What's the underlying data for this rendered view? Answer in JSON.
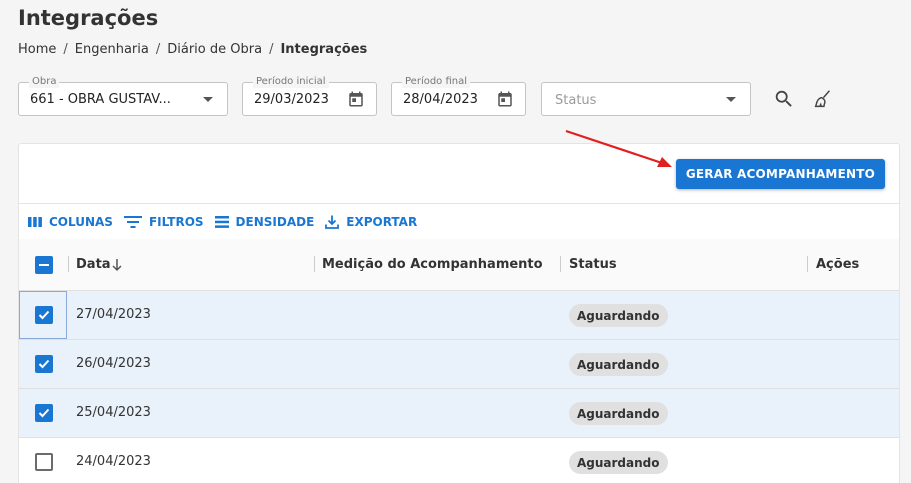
{
  "page": {
    "title": "Integrações"
  },
  "breadcrumb": [
    "Home",
    "Engenharia",
    "Diário de Obra",
    "Integrações"
  ],
  "filters": {
    "obra": {
      "label": "Obra",
      "value": "661 - OBRA GUSTAV..."
    },
    "periodo_inicial": {
      "label": "Período inicial",
      "value": "29/03/2023"
    },
    "periodo_final": {
      "label": "Período final",
      "value": "28/04/2023"
    },
    "status": {
      "placeholder": "Status"
    }
  },
  "actions": {
    "gerar_label": "GERAR ACOMPANHAMENTO"
  },
  "toolbar": {
    "colunas": "COLUNAS",
    "filtros": "FILTROS",
    "densidade": "DENSIDADE",
    "exportar": "EXPORTAR"
  },
  "table": {
    "columns": [
      "Data",
      "Medição do Acompanhamento",
      "Status",
      "Ações"
    ],
    "rows": [
      {
        "date": "27/04/2023",
        "status": "Aguardando",
        "checked": true
      },
      {
        "date": "26/04/2023",
        "status": "Aguardando",
        "checked": true
      },
      {
        "date": "25/04/2023",
        "status": "Aguardando",
        "checked": true
      },
      {
        "date": "24/04/2023",
        "status": "Aguardando",
        "checked": false
      }
    ]
  },
  "colors": {
    "accent": "#1976d2",
    "annotation_arrow": "#e02020"
  }
}
